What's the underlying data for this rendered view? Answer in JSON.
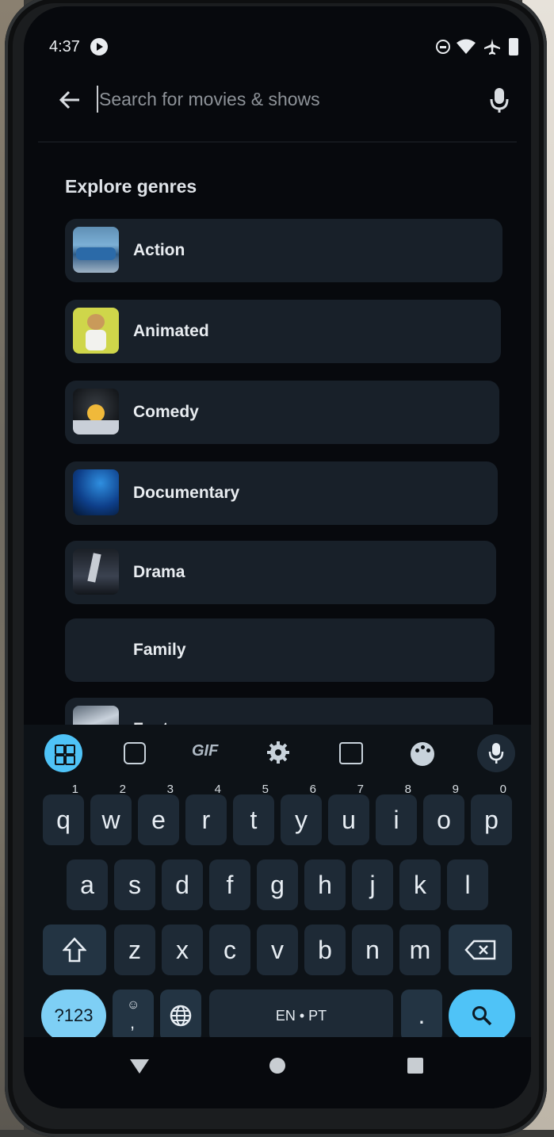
{
  "status_bar": {
    "time": "4:37"
  },
  "search": {
    "placeholder": "Search for movies & shows"
  },
  "section_title": "Explore genres",
  "genres": [
    {
      "label": "Action"
    },
    {
      "label": "Animated"
    },
    {
      "label": "Comedy"
    },
    {
      "label": "Documentary"
    },
    {
      "label": "Drama"
    },
    {
      "label": "Family"
    },
    {
      "label": "Fantasy"
    }
  ],
  "keyboard": {
    "toolbar": [
      "apps-grid-icon",
      "sticker-icon",
      "GIF",
      "settings-icon",
      "translate-icon",
      "palette-icon",
      "mic-icon"
    ],
    "row1": [
      {
        "key": "q",
        "hint": "1"
      },
      {
        "key": "w",
        "hint": "2"
      },
      {
        "key": "e",
        "hint": "3"
      },
      {
        "key": "r",
        "hint": "4"
      },
      {
        "key": "t",
        "hint": "5"
      },
      {
        "key": "y",
        "hint": "6"
      },
      {
        "key": "u",
        "hint": "7"
      },
      {
        "key": "i",
        "hint": "8"
      },
      {
        "key": "o",
        "hint": "9"
      },
      {
        "key": "p",
        "hint": "0"
      }
    ],
    "row2": [
      "a",
      "s",
      "d",
      "f",
      "g",
      "h",
      "j",
      "k",
      "l"
    ],
    "row3": [
      "z",
      "x",
      "c",
      "v",
      "b",
      "n",
      "m"
    ],
    "symbols_label": "?123",
    "comma_label": ",",
    "space_label": "EN • PT",
    "period_label": "."
  },
  "colors": {
    "accent": "#4fc3f7",
    "card": "#182029",
    "screen_bg": "#07090d"
  }
}
